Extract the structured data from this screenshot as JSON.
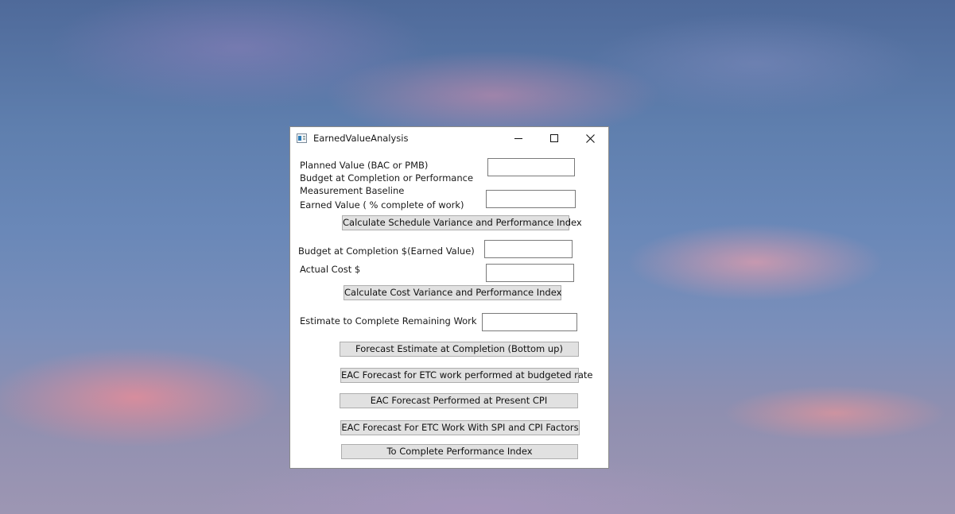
{
  "window": {
    "title": "EarnedValueAnalysis",
    "icon": "app-window-icon",
    "controls": [
      "minimize-icon",
      "maximize-icon",
      "close-icon"
    ]
  },
  "schedule": {
    "planned_value_label": "Planned Value (BAC or PMB)",
    "planned_value_desc1": "Budget at Completion or Performance",
    "planned_value_desc2": "Measurement Baseline",
    "planned_value_input": "",
    "earned_value_label": "Earned Value ( % complete of work)",
    "earned_value_input": "",
    "calc_button": "Calculate Schedule Variance and Performance Index"
  },
  "cost": {
    "bac_label": "Budget at Completion $(Earned Value)",
    "bac_input": "",
    "actual_cost_label": "Actual Cost $",
    "actual_cost_input": "",
    "calc_button": "Calculate Cost Variance and Performance Index"
  },
  "forecast": {
    "etc_label": "Estimate to Complete Remaining Work",
    "etc_input": "",
    "btn_bottom_up": "Forecast Estimate at Completion (Bottom up)",
    "btn_budgeted_rate": "EAC Forecast for ETC work performed at budgeted rate",
    "btn_present_cpi": "EAC Forecast Performed at Present CPI",
    "btn_spi_cpi": "EAC Forecast For ETC Work With SPI and CPI Factors",
    "btn_tcpi": "To Complete Performance Index"
  }
}
